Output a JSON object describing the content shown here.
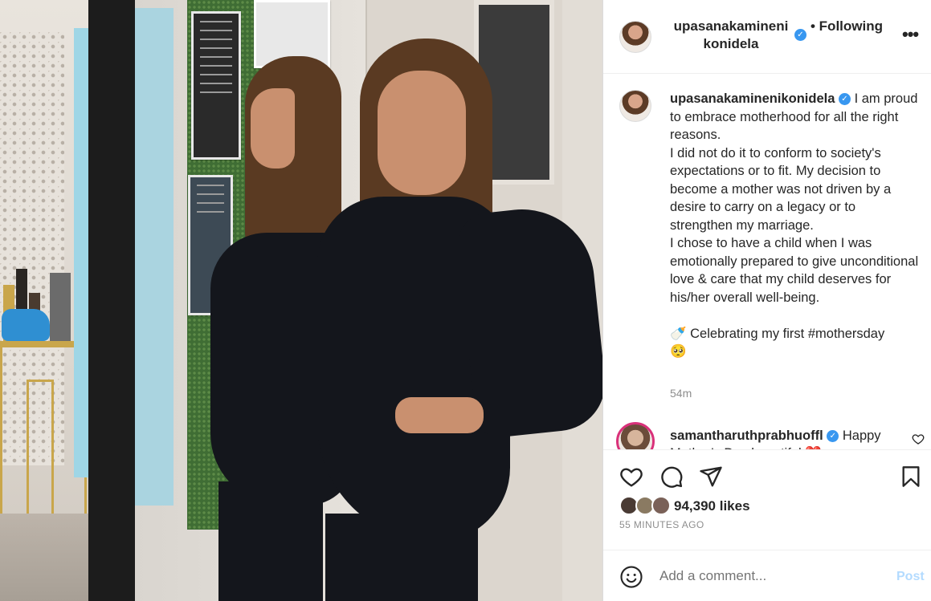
{
  "post": {
    "username_header": "upasanakaminenikonidela",
    "follow_status": "• Following",
    "more_icon": "more-horizontal-icon",
    "caption": {
      "username": "upasanakaminenikonidela",
      "text": " I am proud to embrace motherhood for all the right reasons.\nI did not do it to conform to society's expectations or to fit. My decision to become a mother was not driven by a desire to carry on a legacy or to strengthen my marriage.\nI chose to have a child when I was emotionally prepared to give unconditional love & care that my child deserves for his/her overall well-being.\n\n🍼 Celebrating my first #mothersday\n🥺",
      "time": "54m"
    },
    "comment": {
      "username": "samantharuthprabhuoffl",
      "text": " Happy Mother's Day beautiful ❤️"
    },
    "likes": "94,390 likes",
    "posted_ago": "55 MINUTES AGO",
    "add_comment_placeholder": "Add a comment...",
    "post_button": "Post"
  },
  "colors": {
    "verified": "#3897f0",
    "post_button": "#b3dbff",
    "muted": "#8e8e8e"
  }
}
